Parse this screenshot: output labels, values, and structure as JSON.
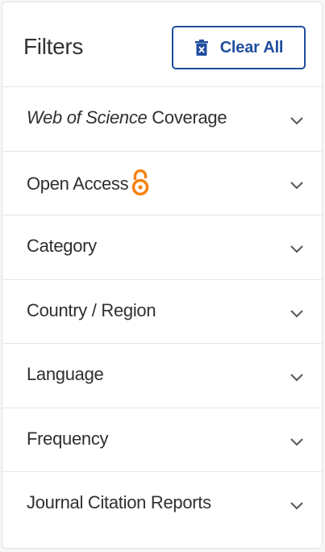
{
  "header": {
    "title": "Filters",
    "clear_all_label": "Clear All"
  },
  "filters": [
    {
      "label_italic": "Web of Science",
      "label": "Coverage",
      "icon": "chevron-down-icon"
    },
    {
      "label": "Open Access",
      "badge_icon": "open-access-icon",
      "icon": "chevron-down-icon"
    },
    {
      "label": "Category",
      "icon": "chevron-down-icon"
    },
    {
      "label": "Country / Region",
      "icon": "chevron-down-icon"
    },
    {
      "label": "Language",
      "icon": "chevron-down-icon"
    },
    {
      "label": "Frequency",
      "icon": "chevron-down-icon"
    },
    {
      "label": "Journal Citation Reports",
      "icon": "chevron-down-icon"
    }
  ],
  "colors": {
    "accent": "#1f4e9e",
    "open_access": "#f68212",
    "text": "#2f2f2f",
    "divider": "#e4e6e9"
  }
}
